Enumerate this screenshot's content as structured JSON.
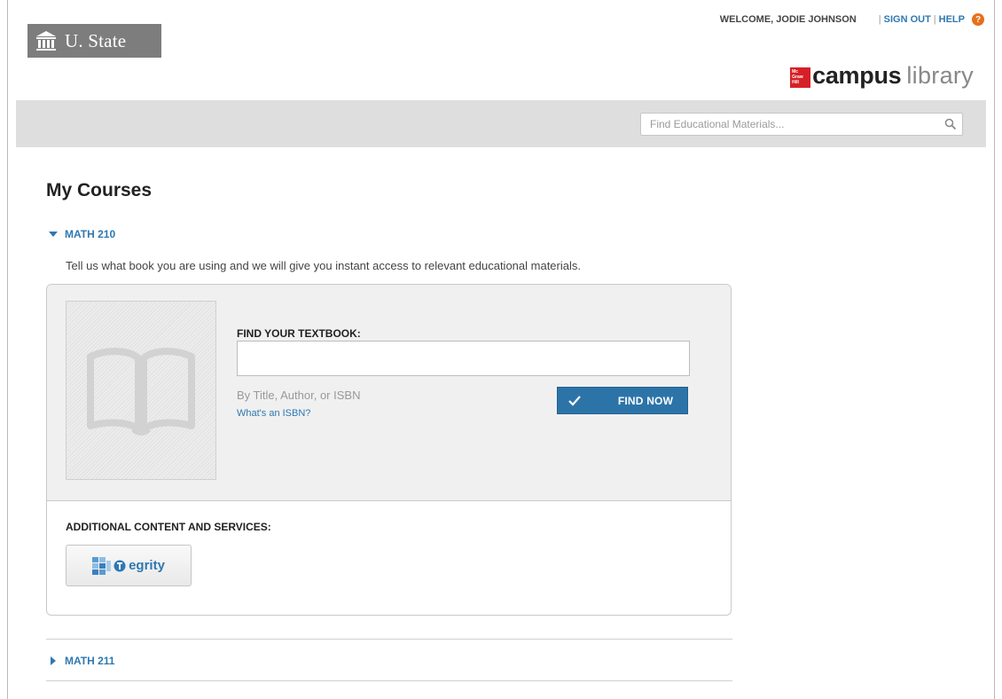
{
  "header": {
    "logo_text": "U. State",
    "welcome_text": "WELCOME, JODIE JOHNSON",
    "sign_out_label": "SIGN OUT",
    "help_label": "HELP",
    "help_badge": "?",
    "brand_bold": "campus",
    "brand_light": "library",
    "brand_badge": "Mc Graw Hill"
  },
  "search": {
    "placeholder": "Find Educational Materials..."
  },
  "page": {
    "title": "My Courses"
  },
  "courses": [
    {
      "name": "MATH 210",
      "expanded": true,
      "intro": "Tell us what book you are using and we will give you instant access to relevant educational materials.",
      "find_label": "FIND YOUR TEXTBOOK:",
      "find_value": "",
      "hint": "By Title, Author, or ISBN",
      "isbn_link": "What's an ISBN?",
      "find_button": "FIND NOW",
      "additional_label": "ADDITIONAL CONTENT AND SERVICES:",
      "service_label": "egrity"
    },
    {
      "name": "MATH 211",
      "expanded": false
    }
  ],
  "colors": {
    "link": "#2f78b1",
    "button": "#2c74a8",
    "band": "#dedede",
    "help": "#e8701a",
    "brand_red": "#d62027"
  }
}
